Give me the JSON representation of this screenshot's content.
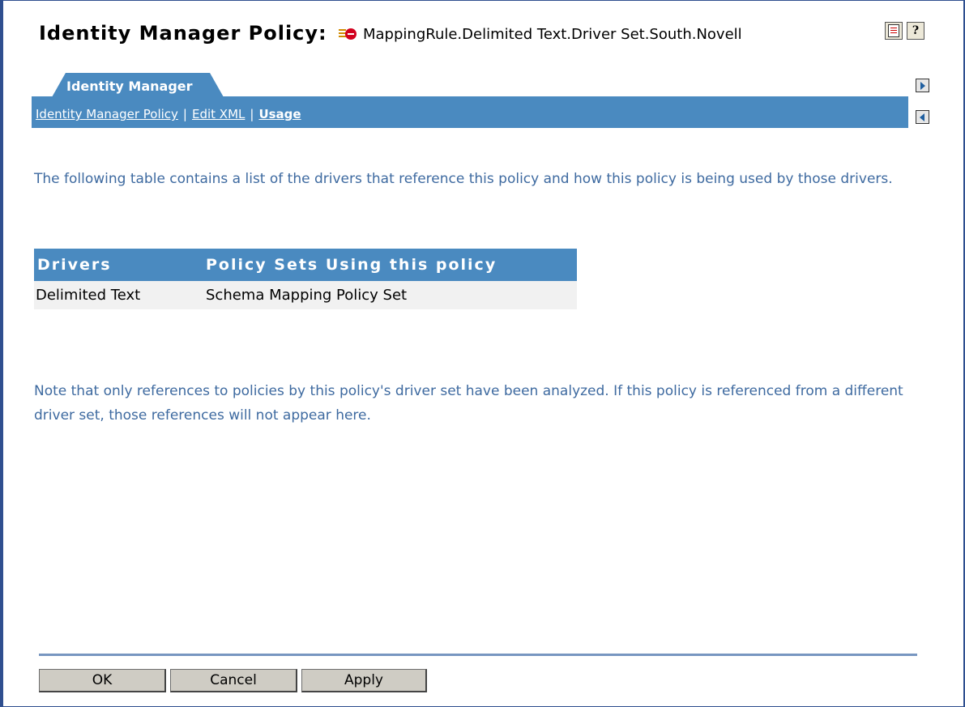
{
  "header": {
    "title": "Identity Manager Policy:",
    "object_name": "MappingRule.Delimited Text.Driver Set.South.Novell",
    "object_icon": "policy-object-icon",
    "tasks_icon": "tasks-icon",
    "help_icon": "help-icon",
    "help_glyph": "?"
  },
  "tabs": {
    "active": "Identity Manager",
    "links": [
      {
        "label": "Identity Manager Policy",
        "current": false
      },
      {
        "label": "Edit XML",
        "current": false
      },
      {
        "label": "Usage",
        "current": true
      }
    ],
    "separator": "|"
  },
  "main": {
    "intro": "The following table contains a list of the drivers that reference this policy and how this policy is being used by those drivers.",
    "table": {
      "headers": [
        "Drivers",
        "Policy Sets Using this policy"
      ],
      "rows": [
        [
          "Delimited Text",
          "Schema Mapping Policy Set"
        ]
      ]
    },
    "note": "Note that only references to policies by this policy's driver set have been analyzed.  If this policy is referenced from a different driver set, those references will not appear here."
  },
  "buttons": {
    "ok": "OK",
    "cancel": "Cancel",
    "apply": "Apply"
  },
  "colors": {
    "accent": "#4a8ac0",
    "body_text": "#3e6aa0",
    "frame": "#2f4f8f"
  }
}
